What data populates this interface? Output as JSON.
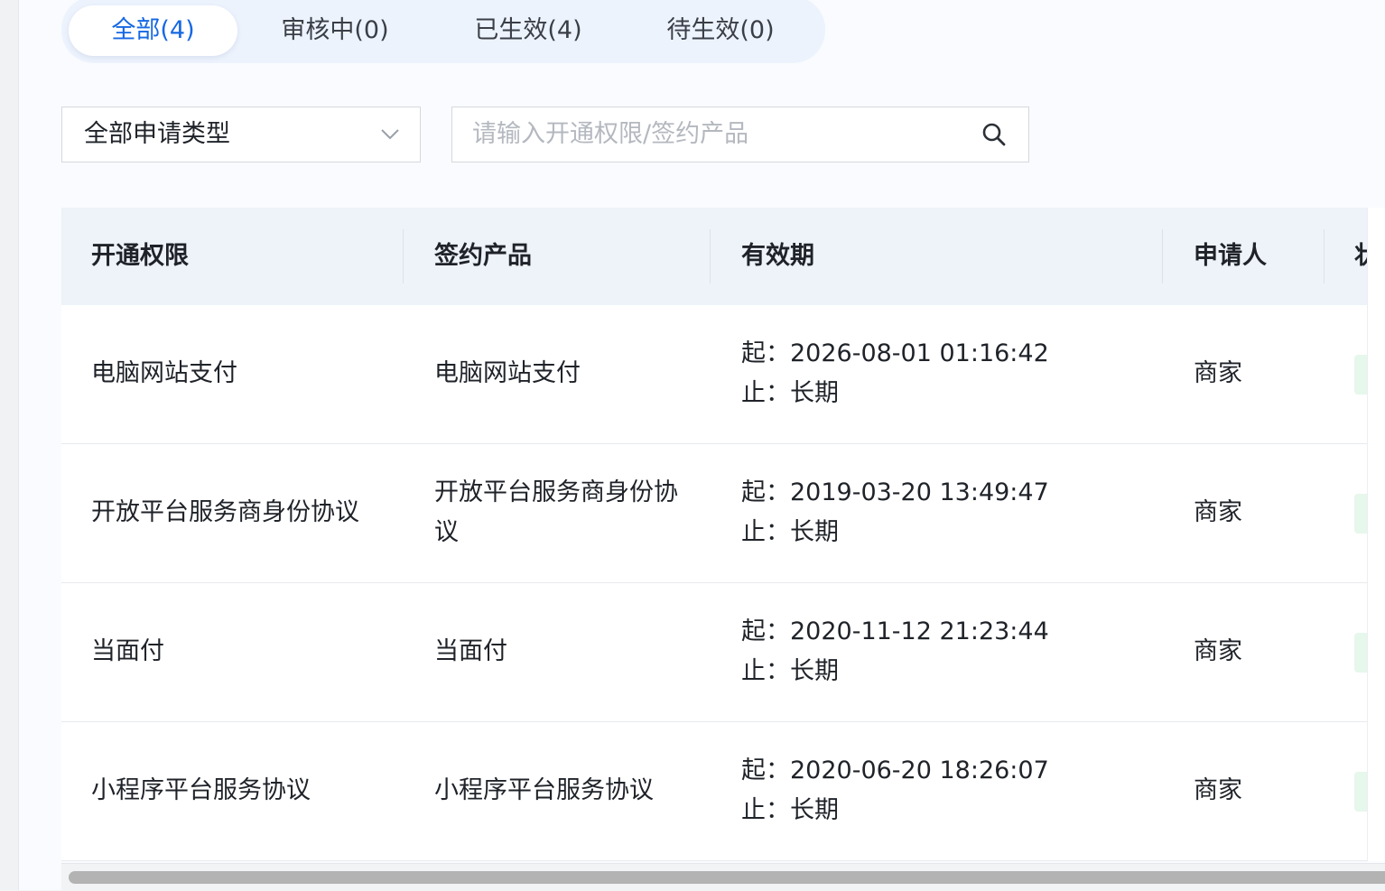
{
  "tabs": [
    {
      "label": "全部(4)",
      "active": true
    },
    {
      "label": "审核中(0)",
      "active": false
    },
    {
      "label": "已生效(4)",
      "active": false
    },
    {
      "label": "待生效(0)",
      "active": false
    }
  ],
  "filters": {
    "type_select_value": "全部申请类型",
    "search_placeholder": "请输入开通权限/签约产品"
  },
  "table": {
    "columns": [
      "开通权限",
      "签约产品",
      "有效期",
      "申请人",
      "状"
    ],
    "rows": [
      {
        "permission": "电脑网站支付",
        "product": "电脑网站支付",
        "start": "起：2026-08-01 01:16:42",
        "end": "止：长期",
        "applicant": "商家"
      },
      {
        "permission": "开放平台服务商身份协议",
        "product": "开放平台服务商身份协议",
        "start": "起：2019-03-20 13:49:47",
        "end": "止：长期",
        "applicant": "商家"
      },
      {
        "permission": "当面付",
        "product": "当面付",
        "start": "起：2020-11-12 21:23:44",
        "end": "止：长期",
        "applicant": "商家"
      },
      {
        "permission": "小程序平台服务协议",
        "product": "小程序平台服务协议",
        "start": "起：2020-06-20 18:26:07",
        "end": "止：长期",
        "applicant": "商家"
      }
    ]
  },
  "icons": {
    "select_chevron": "chevron-down-icon",
    "search": "search-icon"
  },
  "colors": {
    "accent": "#1668e3",
    "tab_bar_bg": "#edf3fd",
    "header_bg": "#eef2f9",
    "status_chip": "#e6f7ec"
  }
}
